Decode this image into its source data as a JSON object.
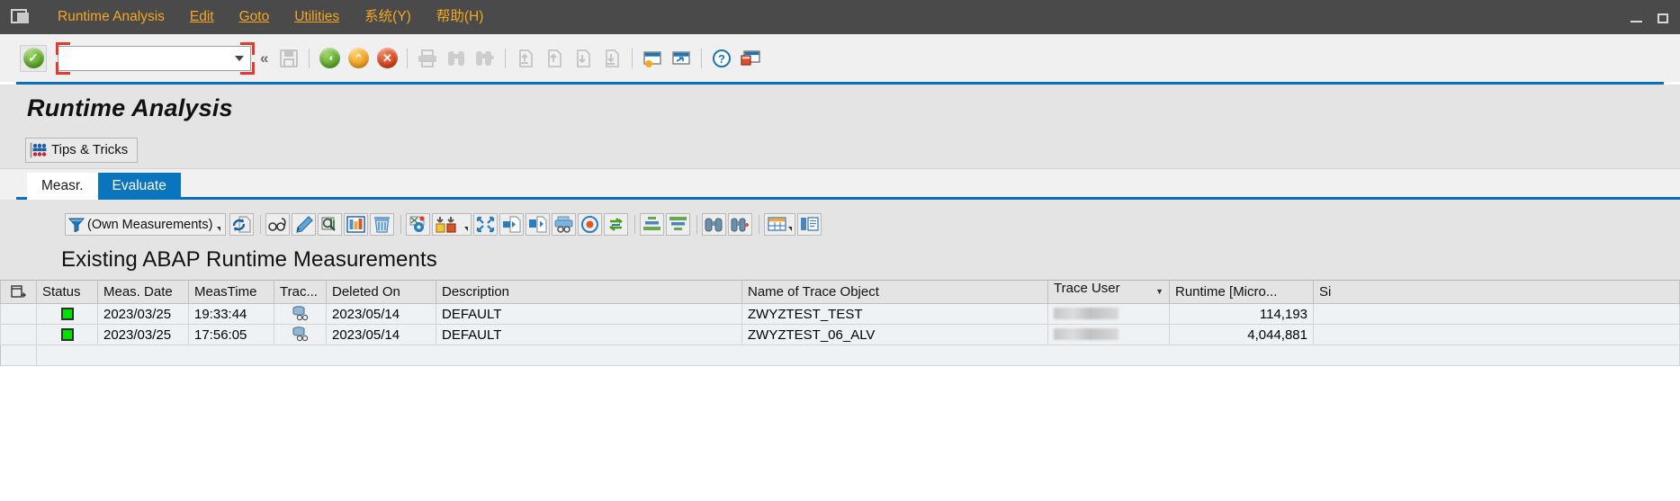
{
  "window": {
    "minimize_label": "Minimize",
    "maximize_label": "Maximize"
  },
  "menu": {
    "system_icon": "sap-session-icon",
    "items": [
      {
        "label": "Runtime Analysis",
        "accel_index": 11
      },
      {
        "label": "Edit",
        "accel_index": 0
      },
      {
        "label": "Goto",
        "accel_index": 0
      },
      {
        "label": "Utilities",
        "accel_index": 0
      },
      {
        "label": "系统(Y)",
        "accel_index": -1
      },
      {
        "label": "帮助(H)",
        "accel_index": -1
      }
    ]
  },
  "toolbar": {
    "enter_label": "Enter",
    "command_field": {
      "value": "",
      "placeholder": ""
    },
    "more_label": "«",
    "buttons": [
      {
        "name": "save-button",
        "label": "Save",
        "enabled": false
      },
      {
        "name": "back-button",
        "label": "Back",
        "enabled": true
      },
      {
        "name": "exit-button",
        "label": "Exit",
        "enabled": true
      },
      {
        "name": "cancel-button",
        "label": "Cancel",
        "enabled": true
      },
      {
        "name": "print-button",
        "label": "Print",
        "enabled": false
      },
      {
        "name": "find-button",
        "label": "Find",
        "enabled": false
      },
      {
        "name": "find-next-button",
        "label": "Find Next",
        "enabled": false
      },
      {
        "name": "first-page-button",
        "label": "First Page",
        "enabled": false
      },
      {
        "name": "previous-page-button",
        "label": "Previous Page",
        "enabled": false
      },
      {
        "name": "next-page-button",
        "label": "Next Page",
        "enabled": false
      },
      {
        "name": "last-page-button",
        "label": "Last Page",
        "enabled": false
      },
      {
        "name": "create-session-button",
        "label": "Create New Session",
        "enabled": true
      },
      {
        "name": "create-shortcut-button",
        "label": "Create Shortcut",
        "enabled": true
      },
      {
        "name": "help-button",
        "label": "Help",
        "enabled": true
      },
      {
        "name": "customize-layout-button",
        "label": "Customize Local Layout",
        "enabled": true
      }
    ]
  },
  "page": {
    "title": "Runtime Analysis"
  },
  "app_toolbar": {
    "tips_button": "Tips & Tricks"
  },
  "tabs": [
    {
      "label": "Measr.",
      "active": false
    },
    {
      "label": "Evaluate",
      "active": true
    }
  ],
  "alv_toolbar": {
    "filter_label": "(Own Measurements)",
    "buttons": [
      {
        "name": "refresh-button",
        "label": "Refresh"
      },
      {
        "name": "display-button",
        "label": "Display"
      },
      {
        "name": "edit-button",
        "label": "Change"
      },
      {
        "name": "analyze-button",
        "label": "Evaluate"
      },
      {
        "name": "statistics-button",
        "label": "Statistics"
      },
      {
        "name": "delete-button",
        "label": "Delete"
      },
      {
        "name": "settings-button",
        "label": "Settings"
      },
      {
        "name": "compare-button",
        "label": "Compare Measurements"
      },
      {
        "name": "expand-button",
        "label": "Expand"
      },
      {
        "name": "export-button",
        "label": "Export"
      },
      {
        "name": "import-button",
        "label": "Import"
      },
      {
        "name": "print-preview-button",
        "label": "Print Preview"
      },
      {
        "name": "record-button",
        "label": "Record"
      },
      {
        "name": "refresh-trace-button",
        "label": "Refresh Trace"
      },
      {
        "name": "sort-ascending-button",
        "label": "Sort Ascending"
      },
      {
        "name": "sort-descending-button",
        "label": "Sort Descending"
      },
      {
        "name": "find-button",
        "label": "Find"
      },
      {
        "name": "find-next-button",
        "label": "Find Next"
      },
      {
        "name": "layout-button",
        "label": "Select Layout"
      },
      {
        "name": "detail-button",
        "label": "Detail"
      }
    ]
  },
  "grid": {
    "title": "Existing ABAP Runtime Measurements",
    "columns": [
      {
        "key": "rowhdr",
        "label": ""
      },
      {
        "key": "status",
        "label": "Status"
      },
      {
        "key": "meas_date",
        "label": "Meas. Date"
      },
      {
        "key": "meas_time",
        "label": "MeasTime"
      },
      {
        "key": "trace",
        "label": "Trac..."
      },
      {
        "key": "deleted_on",
        "label": "Deleted On"
      },
      {
        "key": "description",
        "label": "Description"
      },
      {
        "key": "trace_object",
        "label": "Name of Trace Object"
      },
      {
        "key": "trace_user",
        "label": "Trace User",
        "sorted": true
      },
      {
        "key": "runtime",
        "label": "Runtime [Micro..."
      },
      {
        "key": "size",
        "label": "Si"
      }
    ],
    "rows": [
      {
        "status": "green",
        "meas_date": "2023/03/25",
        "meas_time": "19:33:44",
        "trace": "trace-db-icon",
        "deleted_on": "2023/05/14",
        "description": "DEFAULT",
        "trace_object": "ZWYZTEST_TEST",
        "trace_user": "",
        "runtime": "114,193",
        "size": ""
      },
      {
        "status": "green",
        "meas_date": "2023/03/25",
        "meas_time": "17:56:05",
        "trace": "trace-db-icon",
        "deleted_on": "2023/05/14",
        "description": "DEFAULT",
        "trace_object": "ZWYZTEST_06_ALV",
        "trace_user": "",
        "runtime": "4,044,881",
        "size": ""
      }
    ]
  },
  "colors": {
    "menu_bg": "#4a4a4a",
    "menu_text": "#f5a623",
    "accent_blue": "#0a6ebd",
    "tab_active_bg": "#0a74bd",
    "panel_bg": "#e4e4e4",
    "row_bg": "#eff2f5",
    "status_green": "#00e300",
    "command_border_highlight": "#e23b2e"
  }
}
